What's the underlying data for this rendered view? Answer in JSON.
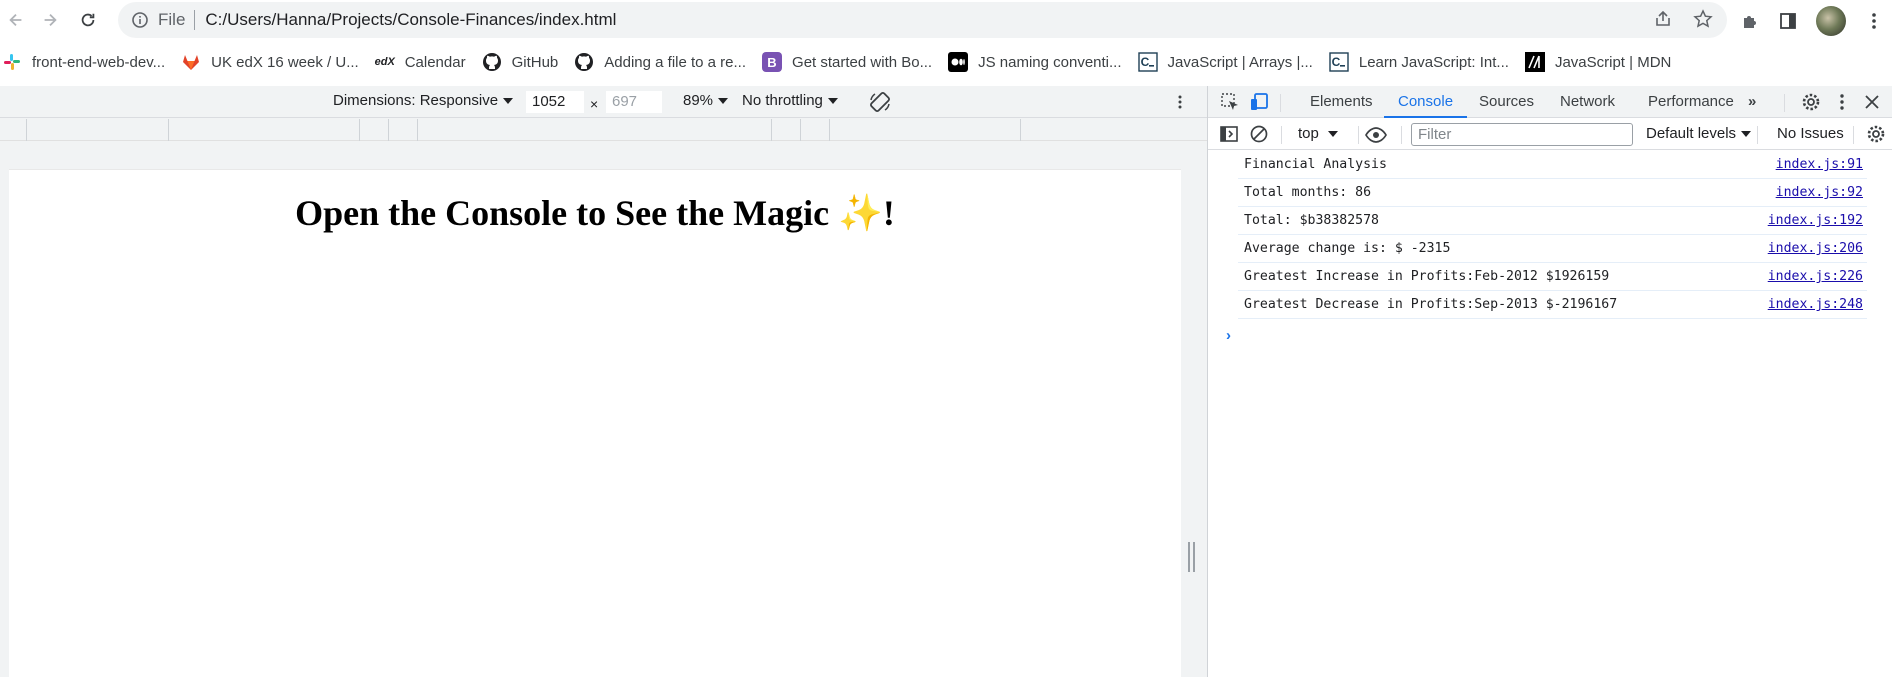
{
  "browser": {
    "scheme_label": "File",
    "url": "C:/Users/Hanna/Projects/Console-Finances/index.html"
  },
  "bookmarks": [
    {
      "label": "front-end-web-dev...",
      "icon": "slack-icon"
    },
    {
      "label": "UK edX 16 week / U...",
      "icon": "gitlab-icon"
    },
    {
      "label": "Calendar",
      "icon": "edx-icon"
    },
    {
      "label": "GitHub",
      "icon": "github-icon"
    },
    {
      "label": "Adding a file to a re...",
      "icon": "github-icon"
    },
    {
      "label": "Get started with Bo...",
      "icon": "bootstrap-icon"
    },
    {
      "label": "JS naming conventi...",
      "icon": "medium-icon"
    },
    {
      "label": "JavaScript | Arrays |...",
      "icon": "codecademy-icon"
    },
    {
      "label": "Learn JavaScript: Int...",
      "icon": "codecademy-icon"
    },
    {
      "label": "JavaScript | MDN",
      "icon": "mdn-icon"
    }
  ],
  "device_toolbar": {
    "dimensions_label": "Dimensions: Responsive",
    "width_value": "1052",
    "height_placeholder": "697",
    "times": "×",
    "zoom": "89%",
    "throttling": "No throttling"
  },
  "page": {
    "heading": "Open the Console to See the Magic ✨!"
  },
  "devtools": {
    "tabs": [
      "Elements",
      "Console",
      "Sources",
      "Network",
      "Performance"
    ],
    "active_tab": "Console",
    "context": "top",
    "filter_placeholder": "Filter",
    "levels": "Default levels",
    "issues": "No Issues",
    "logs": [
      {
        "message": "Financial Analysis",
        "source": "index.js:91"
      },
      {
        "message": "Total months: 86",
        "source": "index.js:92"
      },
      {
        "message": "Total: $b38382578",
        "source": "index.js:192"
      },
      {
        "message": "Average change is: $ -2315",
        "source": "index.js:206"
      },
      {
        "message": "Greatest Increase in Profits:Feb-2012 $1926159",
        "source": "index.js:226"
      },
      {
        "message": "Greatest Decrease in Profits:Sep-2013 $-2196167",
        "source": "index.js:248"
      }
    ],
    "prompt_symbol": "›"
  },
  "colors": {
    "accent": "#1a73e8",
    "link": "#1a0dab",
    "toolbar_bg": "#f1f3f4"
  }
}
